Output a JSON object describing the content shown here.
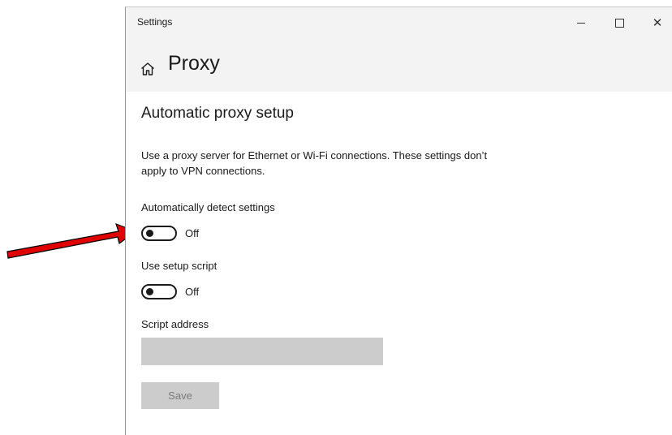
{
  "window": {
    "title": "Settings",
    "minimize_icon": "minimize-icon",
    "maximize_icon": "maximize-icon",
    "close_icon": "close-icon",
    "close_glyph": "✕"
  },
  "header": {
    "icon": "home-icon",
    "title": "Proxy"
  },
  "section": {
    "title": "Automatic proxy setup",
    "description": "Use a proxy server for Ethernet or Wi-Fi connections. These settings don’t apply to VPN connections."
  },
  "auto_detect": {
    "label": "Automatically detect settings",
    "state": "Off"
  },
  "setup_script": {
    "label": "Use setup script",
    "state": "Off"
  },
  "script_address": {
    "label": "Script address",
    "value": "",
    "placeholder": ""
  },
  "save_button": {
    "label": "Save"
  },
  "annotation": {
    "arrow_color": "#e00000"
  }
}
